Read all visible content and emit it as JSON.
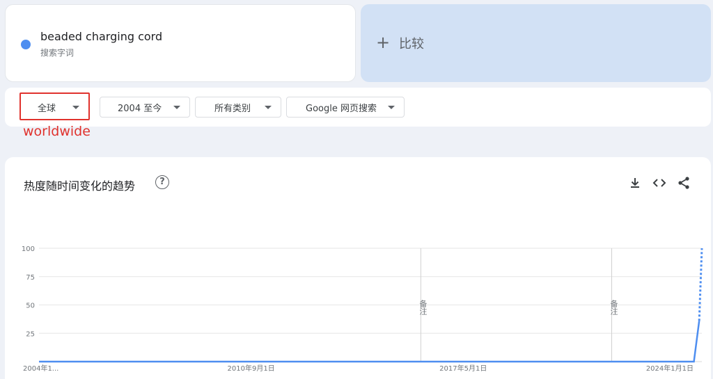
{
  "term": {
    "name": "beaded charging cord",
    "type_label": "搜索字词",
    "color": "#4e8ef0"
  },
  "compare": {
    "plus": "+",
    "label": "比较"
  },
  "filters": [
    {
      "label": "全球"
    },
    {
      "label": "2004 至今"
    },
    {
      "label": "所有类别"
    },
    {
      "label": "Google 网页搜索"
    }
  ],
  "annotation": {
    "text": "worldwide",
    "color": "#e0322d"
  },
  "chart_section": {
    "title": "热度随时间变化的趋势",
    "help": "?"
  },
  "chart_data": {
    "type": "line",
    "title": "热度随时间变化的趋势",
    "ylim": [
      0,
      100
    ],
    "yticks": [
      25,
      50,
      75,
      100
    ],
    "xlabel": "",
    "ylabel": "",
    "grid": true,
    "x_tick_labels": [
      "2004年1...",
      "2010年9月1日",
      "2017年5月1日",
      "2024年1月1日"
    ],
    "series": [
      {
        "color": "#4e8ef0",
        "points": [
          {
            "x": "2004-01",
            "y": 0
          },
          {
            "x": "2024-08",
            "y": 0
          },
          {
            "x": "2024-10",
            "y": 36
          }
        ],
        "partial_points": [
          {
            "x": "2024-10",
            "y": 36
          },
          {
            "x": "2024-11",
            "y": 100
          }
        ]
      }
    ],
    "annotations": [
      {
        "x": "2016-01",
        "label": "备注"
      },
      {
        "x": "2022-01",
        "label": "备注"
      }
    ]
  }
}
